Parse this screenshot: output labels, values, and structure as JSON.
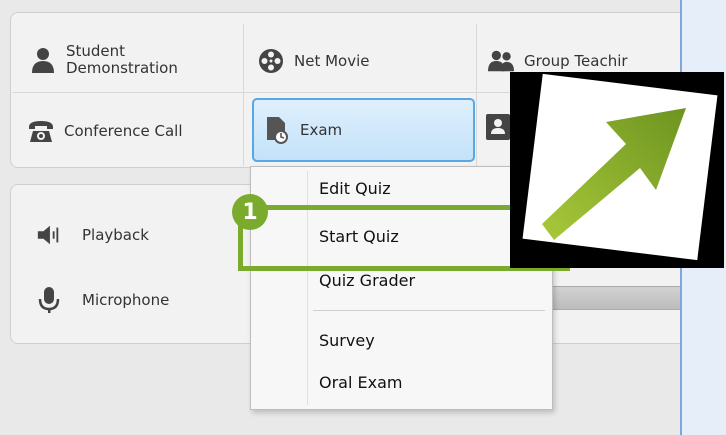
{
  "toolbar": {
    "student_demo_label_line1": "Student",
    "student_demo_label_line2": "Demonstration",
    "net_movie_label": "Net Movie",
    "group_teaching_label": "Group Teachir",
    "conference_call_label": "Conference Call",
    "exam_label": "Exam"
  },
  "audio": {
    "playback_label": "Playback",
    "microphone_label": "Microphone"
  },
  "exam_menu": {
    "items": [
      "Edit Quiz",
      "Start Quiz",
      "Quiz Grader",
      "Survey",
      "Oral Exam"
    ]
  },
  "callout": {
    "step_number": "1",
    "highlight_color": "#7bab2d",
    "arrow_color": "#8cb52a"
  }
}
